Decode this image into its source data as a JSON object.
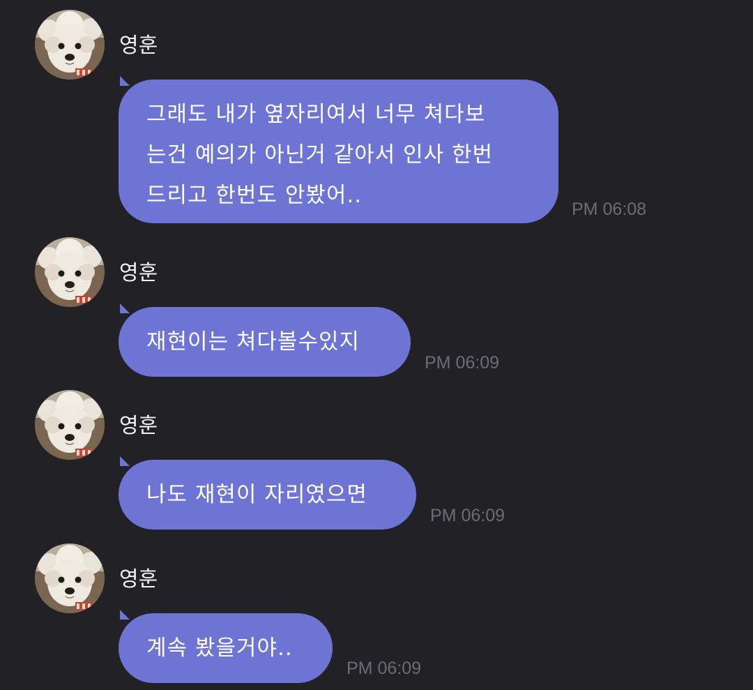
{
  "messages": [
    {
      "sender": "영훈",
      "avatar_icon": "puppy-avatar-icon",
      "lines": [
        "그래도 내가 옆자리여서 너무 쳐다보",
        "는건 예의가 아닌거 같아서 인사 한번",
        "드리고 한번도 안봤어.."
      ],
      "time": "PM 06:08"
    },
    {
      "sender": "영훈",
      "avatar_icon": "puppy-avatar-icon",
      "lines": [
        "재현이는 쳐다볼수있지"
      ],
      "time": "PM 06:09"
    },
    {
      "sender": "영훈",
      "avatar_icon": "puppy-avatar-icon",
      "lines": [
        "나도 재현이 자리였으면"
      ],
      "time": "PM 06:09"
    },
    {
      "sender": "영훈",
      "avatar_icon": "puppy-avatar-icon",
      "lines": [
        "계속 봤을거야.."
      ],
      "time": "PM 06:09"
    }
  ],
  "colors": {
    "background": "#212126",
    "bubble": "#6e74d3",
    "text": "#ffffff",
    "timestamp": "#6c6c74"
  }
}
